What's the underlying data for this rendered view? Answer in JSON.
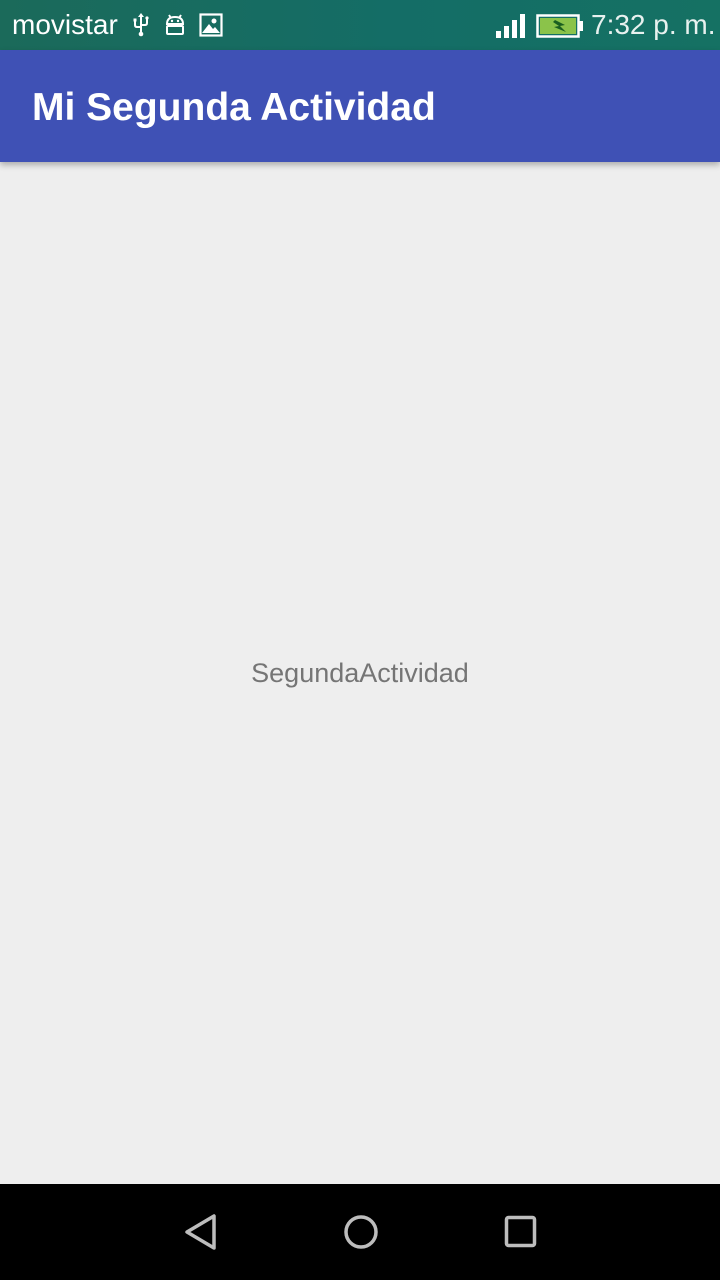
{
  "status_bar": {
    "carrier": "movistar",
    "time": "7:32 p. m.",
    "icons": [
      "usb-icon",
      "android-debug-icon",
      "image-icon",
      "signal-icon",
      "battery-charging-icon"
    ]
  },
  "app_bar": {
    "title": "Mi Segunda Actividad",
    "color": "#3f51b5"
  },
  "content": {
    "text": "SegundaActividad"
  },
  "nav_bar": {
    "buttons": [
      "back-icon",
      "home-icon",
      "recents-icon"
    ]
  }
}
